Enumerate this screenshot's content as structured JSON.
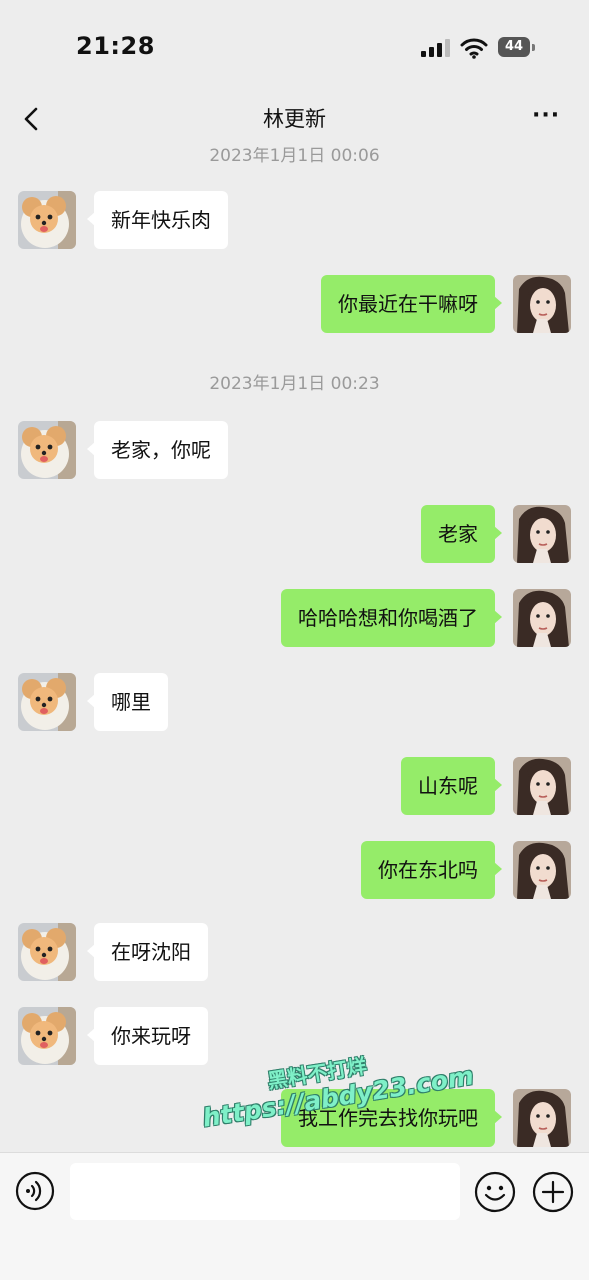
{
  "status_bar": {
    "time": "21:28",
    "battery": "44"
  },
  "nav": {
    "title": "林更新",
    "more_label": "···"
  },
  "messages": [
    {
      "type": "timestamp",
      "text": "2023年1月1日 00:06"
    },
    {
      "type": "msg",
      "side": "left",
      "text": "新年快乐肉"
    },
    {
      "type": "msg",
      "side": "right",
      "text": "你最近在干嘛呀"
    },
    {
      "type": "timestamp",
      "text": "2023年1月1日 00:23"
    },
    {
      "type": "msg",
      "side": "left",
      "text": "老家，你呢"
    },
    {
      "type": "msg",
      "side": "right",
      "text": "老家"
    },
    {
      "type": "msg",
      "side": "right",
      "text": "哈哈哈想和你喝酒了"
    },
    {
      "type": "msg",
      "side": "left",
      "text": "哪里"
    },
    {
      "type": "msg",
      "side": "right",
      "text": "山东呢"
    },
    {
      "type": "msg",
      "side": "right",
      "text": "你在东北吗"
    },
    {
      "type": "msg",
      "side": "left",
      "text": "在呀沈阳"
    },
    {
      "type": "msg",
      "side": "left",
      "text": "你来玩呀"
    },
    {
      "type": "msg",
      "side": "right",
      "text": "我工作完去找你玩吧"
    }
  ],
  "watermark": {
    "line1": "黑料不打烊",
    "line2": "https://abdy23.com"
  },
  "input": {
    "value": ""
  },
  "icons": {
    "back": "chevron-left-icon",
    "more": "more-icon",
    "voice": "voice-icon",
    "emoji": "emoji-icon",
    "plus": "plus-icon",
    "avatar_left": "dog-avatar",
    "avatar_right": "girl-avatar"
  },
  "colors": {
    "background": "#ededed",
    "own_bubble": "#95ec69",
    "other_bubble": "#ffffff",
    "timestamp": "#9a9a9a"
  }
}
